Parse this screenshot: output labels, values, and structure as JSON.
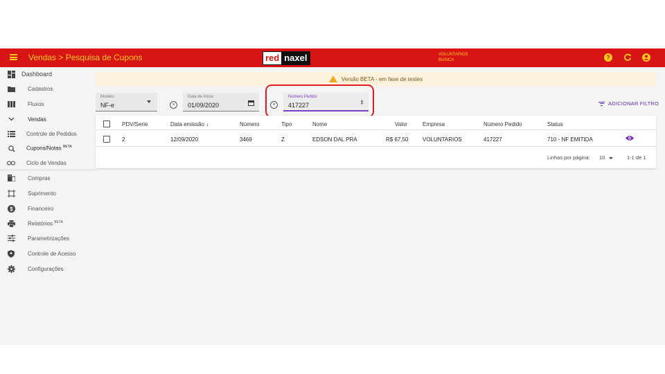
{
  "header": {
    "title": "Vendas > Pesquisa de Cupons",
    "logo_red": "red",
    "logo_naxel": "naxel",
    "user_company": "VOLUNTARIOS",
    "user_name": "BIANCA",
    "help_glyph": "?",
    "colors": {
      "bar": "#d81414",
      "accent": "#ffcc1a"
    }
  },
  "sidebar": {
    "items": [
      {
        "label": "Dashboard",
        "icon": "dashboard-icon"
      },
      {
        "label": "Cadastros",
        "icon": "folder-icon"
      },
      {
        "label": "Fluxos",
        "icon": "columns-icon"
      },
      {
        "label": "Vendas",
        "icon": "chevron-down-icon"
      },
      {
        "label": "Controle de Pedidos",
        "icon": "list-icon"
      },
      {
        "label": "Cupons/Notas",
        "badge": "BETA",
        "icon": "receipt-search-icon"
      },
      {
        "label": "Ciclo de Vendas",
        "icon": "infinity-icon"
      },
      {
        "label": "Compras",
        "icon": "building-icon"
      },
      {
        "label": "Suprimento",
        "icon": "crop-icon"
      },
      {
        "label": "Financeiro",
        "icon": "dollar-icon"
      },
      {
        "label": "Relatórios",
        "badge": "BETA",
        "icon": "printer-icon"
      },
      {
        "label": "Parametrizações",
        "icon": "sliders-icon"
      },
      {
        "label": "Controle de Acesso",
        "icon": "shield-icon"
      },
      {
        "label": "Configurações",
        "icon": "gear-icon"
      }
    ]
  },
  "banner": {
    "text": "Versão BETA - em fase de testes"
  },
  "filters": {
    "modelo": {
      "label": "Modelo",
      "value": "NF-e"
    },
    "data_inicio": {
      "label": "Data de Início",
      "value": "01/09/2020"
    },
    "numero_pedido": {
      "label": "Número Pedido",
      "value": "417227"
    },
    "clear_glyph": "×",
    "stepper_up": "▲",
    "stepper_down": "▼",
    "add_filter_label": "ADICIONAR FILTRO"
  },
  "table": {
    "headers": {
      "pdv": "PDV/Serie",
      "data": "Data emissão ↓",
      "numero": "Número",
      "tipo": "Tipo",
      "nome": "Nome",
      "valor": "Valor",
      "empresa": "Empresa",
      "pedido": "Número Pedido",
      "status": "Status"
    },
    "rows": [
      {
        "pdv": "2",
        "data": "12/09/2020",
        "numero": "3469",
        "tipo": "Z",
        "nome": "EDSON DAL PRA",
        "valor": "R$ 67,50",
        "empresa": "VOLUNTARIOS",
        "pedido": "417227",
        "status": "710 - NF EMITIDA"
      }
    ],
    "pagination": {
      "rows_label": "Linhas por página:",
      "rows_per_page": "10",
      "range": "1-1 de 1"
    }
  }
}
